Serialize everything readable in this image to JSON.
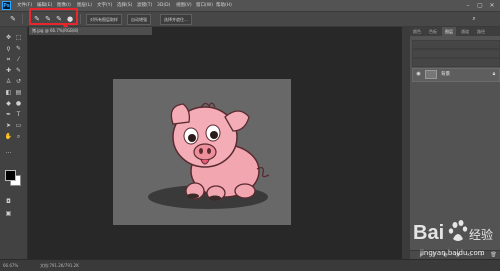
{
  "app": {
    "logo": "Ps"
  },
  "menu": [
    "文件(F)",
    "编辑(E)",
    "图像(I)",
    "图层(L)",
    "文字(Y)",
    "选择(S)",
    "滤镜(T)",
    "3D(D)",
    "视图(V)",
    "窗口(W)",
    "帮助(H)"
  ],
  "window_controls": {
    "minimize": "–",
    "maximize": "▢",
    "close": "✕"
  },
  "options": {
    "mode_buttons": [
      "新选区",
      "添加到选区",
      "从选区减去",
      "与选区交叉"
    ],
    "sample_all_layers": "对所有图层取样",
    "auto_enhance": "自动增强",
    "select_and_mask": "选择并遮住...",
    "search_icon": "search-icon"
  },
  "tools": [
    "move-icon",
    "marquee-icon",
    "lasso-icon",
    "quick-select-icon",
    "crop-icon",
    "eyedropper-icon",
    "healing-icon",
    "brush-icon",
    "stamp-icon",
    "history-brush-icon",
    "eraser-icon",
    "gradient-icon",
    "blur-icon",
    "dodge-icon",
    "pen-icon",
    "type-icon",
    "path-select-icon",
    "shape-icon",
    "hand-icon",
    "zoom-icon"
  ],
  "colors": {
    "foreground": "#000000",
    "background": "#ffffff",
    "annotation": "#e6282e",
    "canvas": "#686868"
  },
  "document": {
    "tab": "猪.jpg @ 66.7%(RGB/8)",
    "zoom": "66.67%",
    "doc_info": "文档:791.2K/791.2K"
  },
  "panels": {
    "tabs": [
      "颜色",
      "色板",
      "图层",
      "通道",
      "路径"
    ],
    "active_tab": "图层",
    "layer_name": "背景"
  },
  "watermark": {
    "logo": "Bai du 经验",
    "url": "jingyan.baidu.com"
  }
}
